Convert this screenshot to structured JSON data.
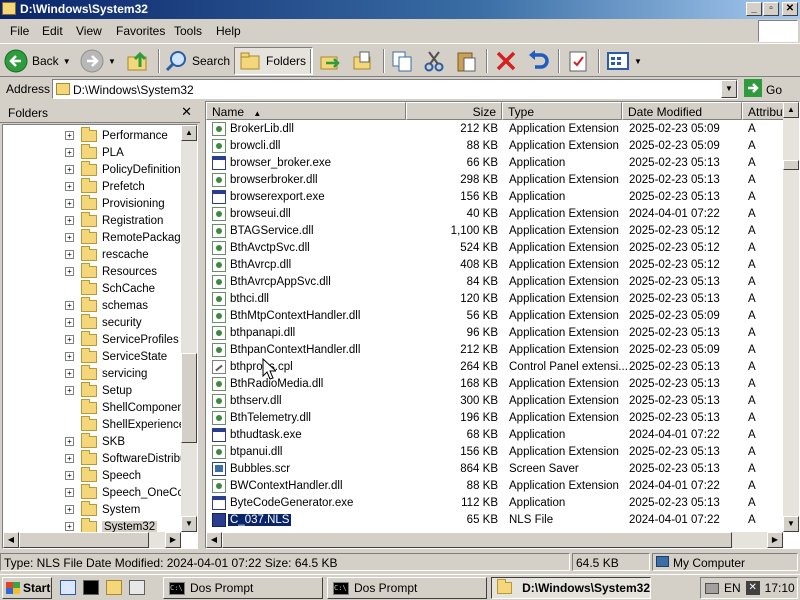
{
  "window": {
    "title": "D:\\Windows\\System32",
    "min_glyph": "_",
    "max_glyph": "▫",
    "close_glyph": "✕"
  },
  "menu": [
    "File",
    "Edit",
    "View",
    "Favorites",
    "Tools",
    "Help"
  ],
  "toolbar": {
    "back_label": "Back",
    "search_label": "Search",
    "folders_label": "Folders"
  },
  "address": {
    "label": "Address",
    "value": "D:\\Windows\\System32",
    "go_label": "Go"
  },
  "folders_panel": {
    "title": "Folders",
    "close_glyph": "✕",
    "items": [
      {
        "label": "Performance",
        "expandable": true
      },
      {
        "label": "PLA",
        "expandable": true
      },
      {
        "label": "PolicyDefinitions",
        "expandable": true
      },
      {
        "label": "Prefetch",
        "expandable": true
      },
      {
        "label": "Provisioning",
        "expandable": true
      },
      {
        "label": "Registration",
        "expandable": true
      },
      {
        "label": "RemotePackages",
        "expandable": true
      },
      {
        "label": "rescache",
        "expandable": true
      },
      {
        "label": "Resources",
        "expandable": true
      },
      {
        "label": "SchCache",
        "expandable": false
      },
      {
        "label": "schemas",
        "expandable": true
      },
      {
        "label": "security",
        "expandable": true
      },
      {
        "label": "ServiceProfiles",
        "expandable": true
      },
      {
        "label": "ServiceState",
        "expandable": true
      },
      {
        "label": "servicing",
        "expandable": true
      },
      {
        "label": "Setup",
        "expandable": true
      },
      {
        "label": "ShellComponents",
        "expandable": false
      },
      {
        "label": "ShellExperiences",
        "expandable": false
      },
      {
        "label": "SKB",
        "expandable": true
      },
      {
        "label": "SoftwareDistribution",
        "expandable": true
      },
      {
        "label": "Speech",
        "expandable": true
      },
      {
        "label": "Speech_OneCore",
        "expandable": true
      },
      {
        "label": "System",
        "expandable": true
      },
      {
        "label": "System32",
        "expandable": true,
        "selected": true
      }
    ]
  },
  "columns": {
    "name": "Name",
    "size": "Size",
    "type": "Type",
    "modified": "Date Modified",
    "attributes": "Attribut"
  },
  "files": [
    {
      "icon": "dll",
      "name": "BrokerLib.dll",
      "size": "212 KB",
      "type": "Application Extension",
      "modified": "2025-02-23 05:09",
      "attr": "A"
    },
    {
      "icon": "dll",
      "name": "browcli.dll",
      "size": "88 KB",
      "type": "Application Extension",
      "modified": "2025-02-23 05:09",
      "attr": "A"
    },
    {
      "icon": "exe",
      "name": "browser_broker.exe",
      "size": "66 KB",
      "type": "Application",
      "modified": "2025-02-23 05:13",
      "attr": "A"
    },
    {
      "icon": "dll",
      "name": "browserbroker.dll",
      "size": "298 KB",
      "type": "Application Extension",
      "modified": "2025-02-23 05:13",
      "attr": "A"
    },
    {
      "icon": "exe",
      "name": "browserexport.exe",
      "size": "156 KB",
      "type": "Application",
      "modified": "2025-02-23 05:13",
      "attr": "A"
    },
    {
      "icon": "dll",
      "name": "browseui.dll",
      "size": "40 KB",
      "type": "Application Extension",
      "modified": "2024-04-01 07:22",
      "attr": "A"
    },
    {
      "icon": "dll",
      "name": "BTAGService.dll",
      "size": "1,100 KB",
      "type": "Application Extension",
      "modified": "2025-02-23 05:12",
      "attr": "A"
    },
    {
      "icon": "dll",
      "name": "BthAvctpSvc.dll",
      "size": "524 KB",
      "type": "Application Extension",
      "modified": "2025-02-23 05:12",
      "attr": "A"
    },
    {
      "icon": "dll",
      "name": "BthAvrcp.dll",
      "size": "408 KB",
      "type": "Application Extension",
      "modified": "2025-02-23 05:12",
      "attr": "A"
    },
    {
      "icon": "dll",
      "name": "BthAvrcpAppSvc.dll",
      "size": "84 KB",
      "type": "Application Extension",
      "modified": "2025-02-23 05:13",
      "attr": "A"
    },
    {
      "icon": "dll",
      "name": "bthci.dll",
      "size": "120 KB",
      "type": "Application Extension",
      "modified": "2025-02-23 05:13",
      "attr": "A"
    },
    {
      "icon": "dll",
      "name": "BthMtpContextHandler.dll",
      "size": "56 KB",
      "type": "Application Extension",
      "modified": "2025-02-23 05:09",
      "attr": "A"
    },
    {
      "icon": "dll",
      "name": "bthpanapi.dll",
      "size": "96 KB",
      "type": "Application Extension",
      "modified": "2025-02-23 05:13",
      "attr": "A"
    },
    {
      "icon": "dll",
      "name": "BthpanContextHandler.dll",
      "size": "212 KB",
      "type": "Application Extension",
      "modified": "2025-02-23 05:09",
      "attr": "A"
    },
    {
      "icon": "cpl",
      "name": "bthprops.cpl",
      "size": "264 KB",
      "type": "Control Panel extensi...",
      "modified": "2025-02-23 05:13",
      "attr": "A"
    },
    {
      "icon": "dll",
      "name": "BthRadioMedia.dll",
      "size": "168 KB",
      "type": "Application Extension",
      "modified": "2025-02-23 05:13",
      "attr": "A"
    },
    {
      "icon": "dll",
      "name": "bthserv.dll",
      "size": "300 KB",
      "type": "Application Extension",
      "modified": "2025-02-23 05:13",
      "attr": "A"
    },
    {
      "icon": "dll",
      "name": "BthTelemetry.dll",
      "size": "196 KB",
      "type": "Application Extension",
      "modified": "2025-02-23 05:13",
      "attr": "A"
    },
    {
      "icon": "exe",
      "name": "bthudtask.exe",
      "size": "68 KB",
      "type": "Application",
      "modified": "2024-04-01 07:22",
      "attr": "A"
    },
    {
      "icon": "dll",
      "name": "btpanui.dll",
      "size": "156 KB",
      "type": "Application Extension",
      "modified": "2025-02-23 05:13",
      "attr": "A"
    },
    {
      "icon": "scr",
      "name": "Bubbles.scr",
      "size": "864 KB",
      "type": "Screen Saver",
      "modified": "2025-02-23 05:13",
      "attr": "A"
    },
    {
      "icon": "dll",
      "name": "BWContextHandler.dll",
      "size": "88 KB",
      "type": "Application Extension",
      "modified": "2024-04-01 07:22",
      "attr": "A"
    },
    {
      "icon": "exe",
      "name": "ByteCodeGenerator.exe",
      "size": "112 KB",
      "type": "Application",
      "modified": "2025-02-23 05:13",
      "attr": "A"
    },
    {
      "icon": "nls",
      "name": "C_037.NLS",
      "size": "65 KB",
      "type": "NLS File",
      "modified": "2024-04-01 07:22",
      "attr": "A",
      "selected": true
    }
  ],
  "status": {
    "info": "Type: NLS File Date Modified: 2024-04-01 07:22 Size: 64.5 KB",
    "size": "64.5 KB",
    "zone": "My Computer"
  },
  "taskbar": {
    "start_label": "Start",
    "tasks": [
      {
        "label": "Dos Prompt",
        "active": false
      },
      {
        "label": "Dos Prompt",
        "active": false
      },
      {
        "label": "D:\\Windows\\System32",
        "active": true
      }
    ],
    "tray": {
      "lang": "EN",
      "clock": "17:10"
    }
  }
}
